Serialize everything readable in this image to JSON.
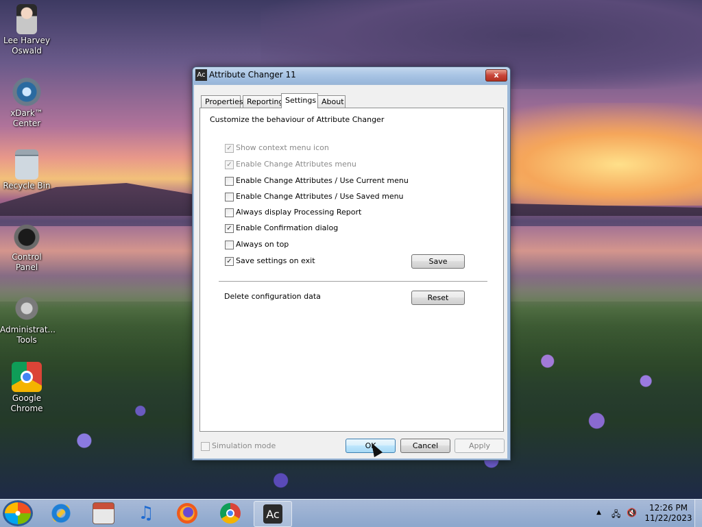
{
  "desktop": {
    "icons": [
      {
        "label": "Lee Harvey Oswald",
        "icon": "user-doll-icon"
      },
      {
        "label": "xDark™ Center",
        "icon": "xdark-center-icon"
      },
      {
        "label": "Recycle Bin",
        "icon": "recycle-bin-icon"
      },
      {
        "label": "Control Panel",
        "icon": "control-panel-icon"
      },
      {
        "label": "Administrative Tools",
        "label_lines": [
          "Administrat...",
          "Tools"
        ],
        "icon": "admin-tools-icon"
      },
      {
        "label": "Google Chrome",
        "label_lines": [
          "Google",
          "Chrome"
        ],
        "icon": "chrome-icon"
      }
    ],
    "icon_labels": {
      "lee_line1": "Lee Harvey",
      "lee_line2": "Oswald",
      "xdark_line1": "xDark™",
      "xdark_line2": "Center",
      "recycle": "Recycle Bin",
      "control_panel": "Control Panel",
      "admin_line1": "Administrat...",
      "admin_line2": "Tools",
      "chrome_line1": "Google",
      "chrome_line2": "Chrome"
    }
  },
  "window": {
    "app_icon_text": "Ac",
    "title": "Attribute Changer 11",
    "close_label": "x"
  },
  "tabs": {
    "properties": "Properties",
    "reporting": "Reporting",
    "settings": "Settings",
    "about": "About",
    "active": "Settings"
  },
  "settings": {
    "heading": "Customize the behaviour of Attribute Changer",
    "options": {
      "show_context_menu_icon": {
        "label": "Show context menu icon",
        "checked": true,
        "enabled": false
      },
      "enable_change_attributes_menu": {
        "label": "Enable Change Attributes menu",
        "checked": true,
        "enabled": false
      },
      "use_current_menu": {
        "label": "Enable Change Attributes / Use Current menu",
        "checked": false,
        "enabled": true
      },
      "use_saved_menu": {
        "label": "Enable Change Attributes / Use Saved menu",
        "checked": false,
        "enabled": true
      },
      "always_display_report": {
        "label": "Always display Processing Report",
        "checked": false,
        "enabled": true
      },
      "enable_confirmation": {
        "label": "Enable Confirmation dialog",
        "checked": true,
        "enabled": true
      },
      "always_on_top": {
        "label": "Always on top",
        "checked": false,
        "enabled": true
      },
      "save_on_exit": {
        "label": "Save settings on exit",
        "checked": true,
        "enabled": true
      }
    },
    "save_button": "Save",
    "delete_config_label": "Delete configuration data",
    "reset_button": "Reset"
  },
  "footer": {
    "simulation_mode": {
      "label": "Simulation mode",
      "checked": false,
      "enabled": false
    },
    "ok": "OK",
    "cancel": "Cancel",
    "apply": "Apply"
  },
  "taskbar": {
    "pinned": [
      "start-orb-icon",
      "internet-explorer-icon",
      "store-icon",
      "music-icon",
      "firefox-icon",
      "chrome-icon",
      "attribute-changer-icon"
    ],
    "ac_text": "Ac",
    "tray_arrow": "▲",
    "clock_time": "12:26 PM",
    "clock_date": "11/22/2023"
  }
}
